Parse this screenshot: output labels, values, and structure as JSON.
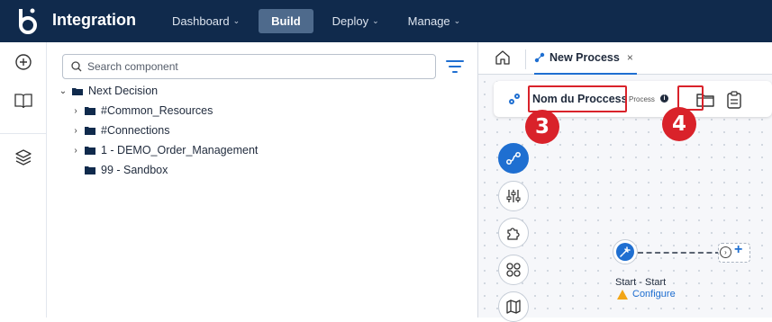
{
  "header": {
    "app_title": "Integration",
    "logo_icon": "boomi-b-logo",
    "nav": [
      {
        "label": "Dashboard",
        "has_dropdown": true,
        "active": false
      },
      {
        "label": "Build",
        "has_dropdown": false,
        "active": true
      },
      {
        "label": "Deploy",
        "has_dropdown": true,
        "active": false
      },
      {
        "label": "Manage",
        "has_dropdown": true,
        "active": false
      }
    ],
    "colors": {
      "bar": "#102a4c",
      "active_nav": "#4e6a8c"
    }
  },
  "left_rail": {
    "icons": [
      "add-circle-icon",
      "book-icon",
      "layers-icon"
    ]
  },
  "component_tree": {
    "search_placeholder": "Search component",
    "root": "Next Decision",
    "children": [
      {
        "label": "#Common_Resources",
        "expandable": true
      },
      {
        "label": "#Connections",
        "expandable": true
      },
      {
        "label": "1 - DEMO_Order_Management",
        "expandable": true
      },
      {
        "label": "99 - Sandbox",
        "expandable": false
      }
    ]
  },
  "editor": {
    "tab_label": "New Process",
    "close_glyph": "×",
    "process_card": {
      "name": "Nom du Proccess",
      "type": "Process",
      "info_glyph": "i"
    },
    "callouts": [
      "3",
      "4"
    ],
    "tools": [
      "connector-shape-icon",
      "settings-sliders-icon",
      "puzzle-icon",
      "grid-circles-icon",
      "map-icon"
    ],
    "start_node": {
      "label": "Start - Start",
      "configure": "Configure",
      "next": "›",
      "add": "+"
    },
    "colors": {
      "accent": "#1f6fd1",
      "callout": "#d9222a",
      "warning": "#f2a516"
    }
  }
}
